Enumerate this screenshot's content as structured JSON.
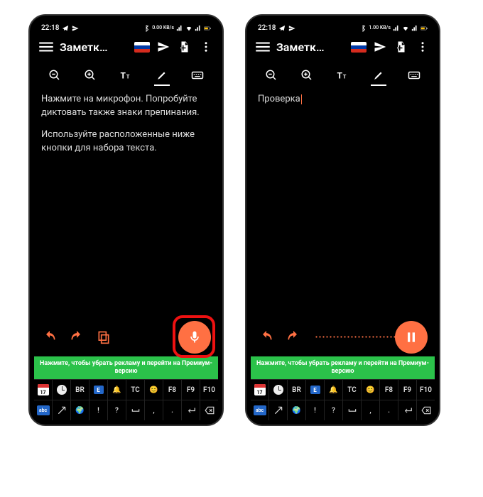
{
  "colors": {
    "accent": "#FF7043",
    "banner": "#2BC24A",
    "highlight": "#e11"
  },
  "status": {
    "time": "22:18",
    "left_icons": [
      "telegram-icon",
      "send-icon"
    ],
    "right_icons": [
      "bluetooth-icon",
      "signal-icon",
      "wifi-icon",
      "signal-icon",
      "battery-icon"
    ],
    "speed_left": "0.00 KB/s",
    "speed_right": "1.00 KB/s"
  },
  "header": {
    "title": "Заметк…",
    "flag": "russia-flag",
    "actions": [
      "send-icon",
      "add-document-icon",
      "more-icon"
    ]
  },
  "toolbar": {
    "items": [
      "zoom-out-icon",
      "zoom-in-icon",
      "text-size-icon",
      "highlighter-icon",
      "keyboard-icon"
    ]
  },
  "left_screen": {
    "paragraphs": [
      "Нажмите на микрофон. Попробуйте диктовать также знаки препинания.",
      "Используйте расположенные ниже кнопки для набора текста."
    ],
    "bottom_controls": [
      "undo-icon",
      "redo-icon",
      "copy-icon"
    ],
    "fab_icon": "microphone-icon",
    "fab_highlighted": true
  },
  "right_screen": {
    "text": "Проверка",
    "bottom_controls": [
      "undo-icon",
      "redo-icon"
    ],
    "waveform": true,
    "fab_icon": "pause-icon"
  },
  "banner": "Нажмите, чтобы убрать рекламу и перейти на Премиум-версию",
  "keyboard": {
    "row1": [
      {
        "type": "calendar",
        "text": "17"
      },
      {
        "type": "clock"
      },
      {
        "type": "text",
        "text": "BR"
      },
      {
        "type": "ebox",
        "text": "E"
      },
      {
        "type": "bell"
      },
      {
        "type": "text",
        "text": "TC"
      },
      {
        "type": "smile"
      },
      {
        "type": "text",
        "text": "F8"
      },
      {
        "type": "text",
        "text": "F9"
      },
      {
        "type": "text",
        "text": "F10"
      }
    ],
    "row2": [
      {
        "type": "abc",
        "text": "abc"
      },
      {
        "type": "arrow"
      },
      {
        "type": "globe"
      },
      {
        "type": "text",
        "text": "!"
      },
      {
        "type": "text",
        "text": "?"
      },
      {
        "type": "space"
      },
      {
        "type": "text",
        "text": ","
      },
      {
        "type": "text",
        "text": "."
      },
      {
        "type": "enter"
      },
      {
        "type": "backspace"
      }
    ]
  }
}
